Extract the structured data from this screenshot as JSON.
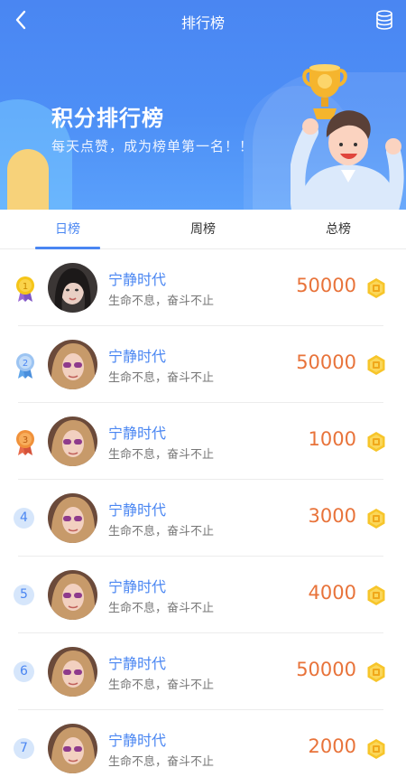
{
  "header": {
    "title": "排行榜",
    "headline": "积分排行榜",
    "subline": "每天点赞，成为榜单第一名！！"
  },
  "tabs": [
    {
      "label": "日榜",
      "active": true
    },
    {
      "label": "周榜",
      "active": false
    },
    {
      "label": "总榜",
      "active": false
    }
  ],
  "colors": {
    "brand": "#4a86f2",
    "score": "#e8733a",
    "gold": "#f5c518",
    "silver": "#9cc4f2",
    "bronze": "#f0913a"
  },
  "icons": {
    "back": "back-arrow-icon",
    "database": "database-icon",
    "coin": "coin-icon",
    "medal_1": "gold-medal-icon",
    "medal_2": "silver-medal-icon",
    "medal_3": "bronze-medal-icon"
  },
  "ranking": [
    {
      "rank": "1",
      "name": "宁静时代",
      "motto": "生命不息，奋斗不止",
      "score": "50000"
    },
    {
      "rank": "2",
      "name": "宁静时代",
      "motto": "生命不息，奋斗不止",
      "score": "50000"
    },
    {
      "rank": "3",
      "name": "宁静时代",
      "motto": "生命不息，奋斗不止",
      "score": "1000"
    },
    {
      "rank": "4",
      "name": "宁静时代",
      "motto": "生命不息，奋斗不止",
      "score": "3000"
    },
    {
      "rank": "5",
      "name": "宁静时代",
      "motto": "生命不息，奋斗不止",
      "score": "4000"
    },
    {
      "rank": "6",
      "name": "宁静时代",
      "motto": "生命不息，奋斗不止",
      "score": "50000"
    },
    {
      "rank": "7",
      "name": "宁静时代",
      "motto": "生命不息，奋斗不止",
      "score": "2000"
    }
  ]
}
